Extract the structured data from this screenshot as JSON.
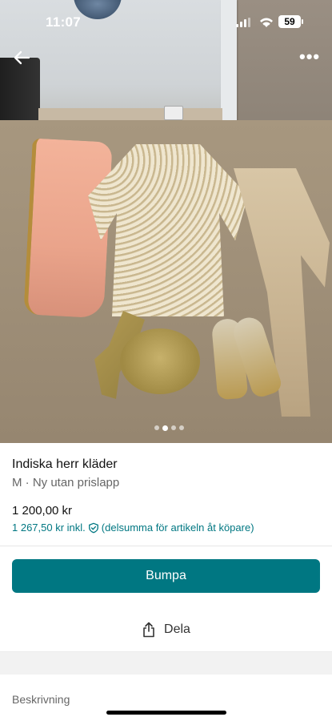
{
  "status_bar": {
    "time": "11:07",
    "battery": "59"
  },
  "listing": {
    "title": "Indiska herr kläder",
    "subtitle": "M · Ny utan prislapp",
    "price": "1 200,00 kr",
    "price_incl": "1 267,50 kr inkl.",
    "price_note": "(delsumma för artikeln åt köpare)"
  },
  "actions": {
    "bump_label": "Bumpa",
    "share_label": "Dela"
  },
  "description": {
    "label": "Beskrivning"
  },
  "gallery": {
    "count": 4,
    "active_index": 1
  },
  "colors": {
    "accent": "#007782"
  },
  "icons": [
    "back-arrow-icon",
    "more-icon",
    "shield-icon",
    "share-icon"
  ]
}
